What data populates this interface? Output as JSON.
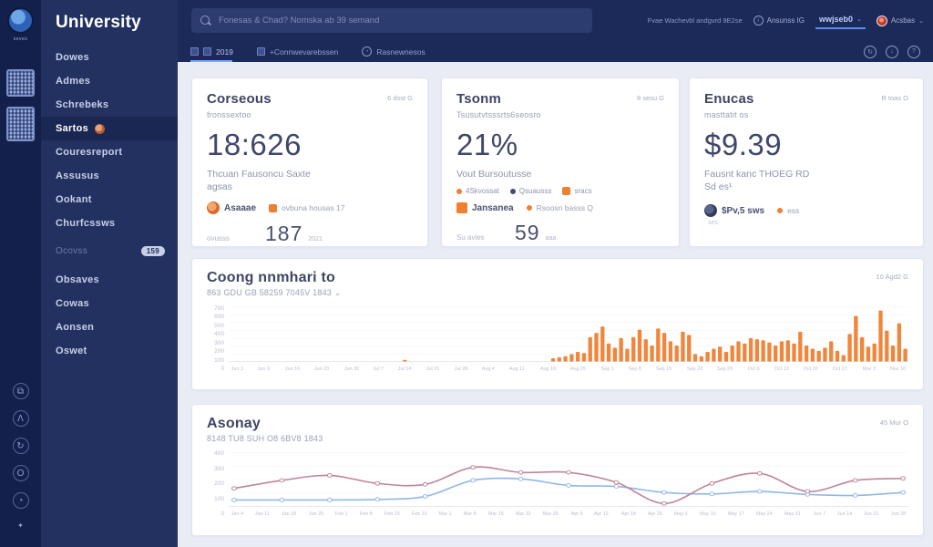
{
  "brand": {
    "title": "University",
    "logo_caption": "seves"
  },
  "rail": {
    "bottom_icons": [
      {
        "name": "grid-icon",
        "glyph": "⧉"
      },
      {
        "name": "caret-icon",
        "glyph": "Λ"
      },
      {
        "name": "refresh-icon",
        "glyph": "↻"
      },
      {
        "name": "circle-icon",
        "glyph": "O"
      },
      {
        "name": "clock-icon",
        "glyph": "◔"
      },
      {
        "name": "dot-icon",
        "glyph": "✦"
      }
    ]
  },
  "sidebar": {
    "items": [
      {
        "label": "Dowes"
      },
      {
        "label": "Admes"
      },
      {
        "label": "Schrebeks"
      },
      {
        "label": "Sartos",
        "active": true
      },
      {
        "label": "Couresreport"
      },
      {
        "label": "Assusus"
      },
      {
        "label": "Ookant"
      },
      {
        "label": "Churfcssws"
      },
      {
        "label": "Ocovss",
        "badge": "159",
        "dim": true
      },
      {
        "label": "Obsaves"
      },
      {
        "label": "Cowas"
      },
      {
        "label": "Aonsen"
      },
      {
        "label": "Oswet"
      }
    ]
  },
  "topbar": {
    "search_placeholder": "Fonesas & Chad? Nomska ab 39 semand",
    "status_text": "Fvae Wachevbl andgvrd 9E2se",
    "notif_label": "Ansunss IG",
    "lang_value": "wwjseb0",
    "profile_label": "Acsbas",
    "chevron": "⌄"
  },
  "tabsrow": {
    "tabs": [
      {
        "label": "2019"
      },
      {
        "label": "+Connwevarebssen"
      },
      {
        "label": "Rasnewnesos"
      }
    ],
    "right_icons": [
      {
        "name": "history-icon",
        "glyph": "↻"
      },
      {
        "name": "download-icon",
        "glyph": "↓"
      },
      {
        "name": "help-icon",
        "glyph": "?"
      }
    ]
  },
  "cards": [
    {
      "title": "Corseous",
      "meta": "6 dsst G",
      "subtitle": "fronssextoo",
      "big": "18:626",
      "line1": "Thcuan Fausoncu Saxte",
      "line2": "agsas",
      "leg_a": "Asaaae",
      "leg_b": "ovbuna housas 17",
      "foot_label": "ovusss",
      "foot_value": "187",
      "foot_small": "2021"
    },
    {
      "title": "Tsonm",
      "meta": "8 sesu G",
      "subtitle": "Tsusutvtsssrts6seosro",
      "big": "21%",
      "line1": "Vout Bursoutusse",
      "mini": [
        "4Skvossat",
        "Qsuausss",
        "sracs"
      ],
      "leg_a": "Jansanea",
      "leg_b": "Rsoosn basss  Q",
      "foot_label": "Su avies",
      "foot_value": "59",
      "foot_small": "aaa"
    },
    {
      "title": "Enucas",
      "meta": "R toas O",
      "subtitle": "masttatit os",
      "big": "$9.39",
      "line1": "Fausnt kanc THOEG RD",
      "line2": "Sd es¹",
      "leg_a": "$Pv,5 sws",
      "leg_b": "ess",
      "foot_small": "ses"
    }
  ],
  "chart_data": [
    {
      "type": "bar",
      "title": "Coong nnmhari to",
      "subtitle": "863 GDU GB 58259 7045V 1843 ⌄",
      "meta": "10 Agd2 G",
      "color": "#f0863b",
      "ylim": [
        0,
        100
      ],
      "ylabels": [
        "700",
        "600",
        "500",
        "400",
        "300",
        "200",
        "100",
        "0"
      ],
      "xlabels": [
        "Jun 2",
        "Jun 9",
        "Jun 16",
        "Jun 23",
        "Jun 30",
        "Jul 7",
        "Jul 14",
        "Jul 21",
        "Jul 28",
        "Aug 4",
        "Aug 11",
        "Aug 18",
        "Aug 25",
        "Sep 1",
        "Sep 8",
        "Sep 15",
        "Sep 22",
        "Sep 29",
        "Oct 6",
        "Oct 13",
        "Oct 20",
        "Oct 27",
        "Nov 3",
        "Nov 10"
      ],
      "values": [
        0,
        0,
        0,
        0,
        0,
        0,
        0,
        0,
        0,
        0,
        0,
        0,
        0,
        0,
        0,
        0,
        0,
        0,
        0,
        0,
        0,
        0,
        0,
        0,
        0,
        0,
        0,
        0,
        3,
        0,
        0,
        0,
        0,
        0,
        0,
        0,
        0,
        0,
        0,
        0,
        0,
        0,
        0,
        0,
        0,
        0,
        0,
        0,
        0,
        0,
        0,
        0,
        6,
        8,
        10,
        14,
        18,
        16,
        46,
        54,
        66,
        34,
        26,
        44,
        24,
        46,
        60,
        42,
        30,
        62,
        54,
        38,
        30,
        56,
        50,
        14,
        10,
        18,
        24,
        28,
        18,
        30,
        38,
        34,
        44,
        42,
        40,
        36,
        30,
        38,
        40,
        34,
        56,
        30,
        24,
        20,
        26,
        38,
        20,
        12,
        52,
        86,
        46,
        28,
        34,
        96,
        58,
        30,
        72,
        24
      ]
    },
    {
      "type": "line",
      "title": "Asonay",
      "subtitle": "8148 TU8 SUH O8 6BV8 1843",
      "meta": "45 Mur O",
      "ylim": [
        0,
        100
      ],
      "ylabels": [
        "400",
        "300",
        "200",
        "100",
        "0"
      ],
      "xlabels": [
        "Jan 4",
        "Jan 11",
        "Jan 18",
        "Jan 25",
        "Feb 1",
        "Feb 8",
        "Feb 15",
        "Feb 22",
        "Mar 1",
        "Mar 8",
        "Mar 15",
        "Mar 22",
        "Mar 29",
        "Apr 5",
        "Apr 12",
        "Apr 19",
        "Apr 26",
        "May 3",
        "May 10",
        "May 17",
        "May 24",
        "May 31",
        "Jun 7",
        "Jun 14",
        "Jun 21",
        "Jun 28"
      ],
      "series": [
        {
          "name": "blue-series",
          "color": "#8fb8e8",
          "values": [
            13,
            13,
            13,
            14,
            20,
            52,
            55,
            42,
            40,
            28,
            25,
            30,
            24,
            22,
            28
          ]
        },
        {
          "name": "pink-series",
          "color": "#c0849a",
          "values": [
            36,
            52,
            62,
            46,
            44,
            78,
            68,
            68,
            48,
            6,
            46,
            66,
            30,
            52,
            56
          ]
        }
      ]
    }
  ]
}
